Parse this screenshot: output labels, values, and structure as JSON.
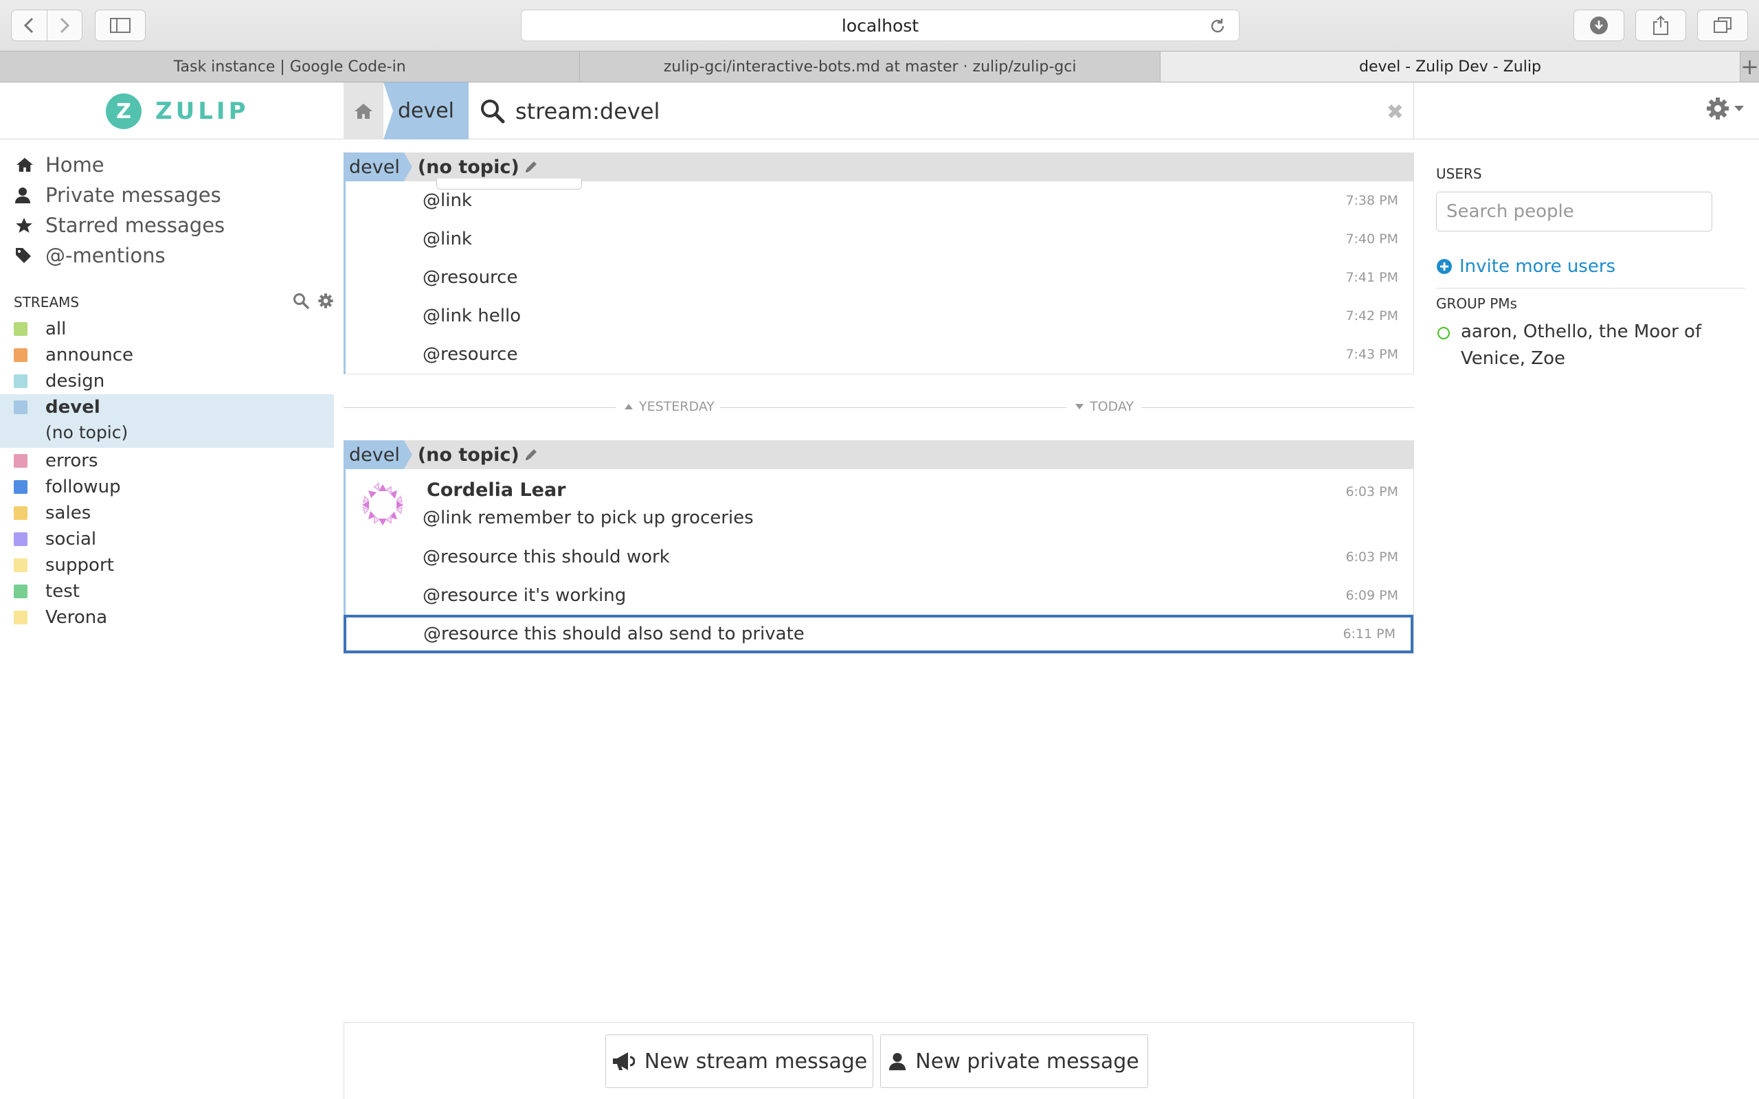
{
  "browser": {
    "address": "localhost",
    "tabs": [
      {
        "label": "Task instance | Google Code-in"
      },
      {
        "label": "zulip-gci/interactive-bots.md at master · zulip/zulip-gci"
      },
      {
        "label": "devel - Zulip Dev - Zulip"
      }
    ],
    "new_tab": "+"
  },
  "header": {
    "logo_letter": "Z",
    "logo_text": "ZULIP",
    "stream_crumb": "devel",
    "search_query": "stream:devel",
    "close": "✖"
  },
  "left_nav": {
    "items": [
      {
        "label": "Home",
        "icon": "home-icon"
      },
      {
        "label": "Private messages",
        "icon": "user-icon"
      },
      {
        "label": "Starred messages",
        "icon": "star-icon"
      },
      {
        "label": "@-mentions",
        "icon": "tag-icon"
      }
    ],
    "streams_heading": "STREAMS",
    "streams": [
      {
        "name": "all",
        "color": "#b6d97a"
      },
      {
        "name": "announce",
        "color": "#f0a35c"
      },
      {
        "name": "design",
        "color": "#a6dce1"
      },
      {
        "name": "devel",
        "color": "#a6c7e5",
        "topic": "(no topic)"
      },
      {
        "name": "errors",
        "color": "#e79ab5"
      },
      {
        "name": "followup",
        "color": "#4f8de4"
      },
      {
        "name": "sales",
        "color": "#f5ce6e"
      },
      {
        "name": "social",
        "color": "#a99cf4"
      },
      {
        "name": "support",
        "color": "#f9e596"
      },
      {
        "name": "test",
        "color": "#76ce90"
      },
      {
        "name": "Verona",
        "color": "#f9e596"
      }
    ]
  },
  "messages": {
    "group1": {
      "stream": "devel",
      "topic": "(no topic)",
      "items": [
        {
          "text": "@link",
          "time": "7:38 PM"
        },
        {
          "text": "@link",
          "time": "7:40 PM"
        },
        {
          "text": "@resource",
          "time": "7:41 PM"
        },
        {
          "text": "@link hello",
          "time": "7:42 PM"
        },
        {
          "text": "@resource",
          "time": "7:43 PM"
        }
      ]
    },
    "separator": {
      "left": "YESTERDAY",
      "right": "TODAY"
    },
    "group2": {
      "stream": "devel",
      "topic": "(no topic)",
      "sender": "Cordelia Lear",
      "items": [
        {
          "text": "@link remember to pick up groceries",
          "time": "6:03 PM"
        },
        {
          "text": "@resource this should work",
          "time": "6:03 PM"
        },
        {
          "text": "@resource it's working",
          "time": "6:09 PM"
        },
        {
          "text": "@resource this should also send to private",
          "time": "6:11 PM"
        }
      ]
    }
  },
  "right": {
    "users_heading": "USERS",
    "search_placeholder": "Search people",
    "invite": "Invite more users",
    "group_heading": "GROUP PMs",
    "group_pm": "aaron, Othello, the Moor of Venice, Zoe"
  },
  "compose": {
    "stream_button": "New stream message",
    "private_button": "New private message"
  },
  "colors": {
    "accent": "#52c2af",
    "stream_devel": "#a6c7e5",
    "selected_border": "#3b73b9",
    "link": "#1d8ccc"
  }
}
